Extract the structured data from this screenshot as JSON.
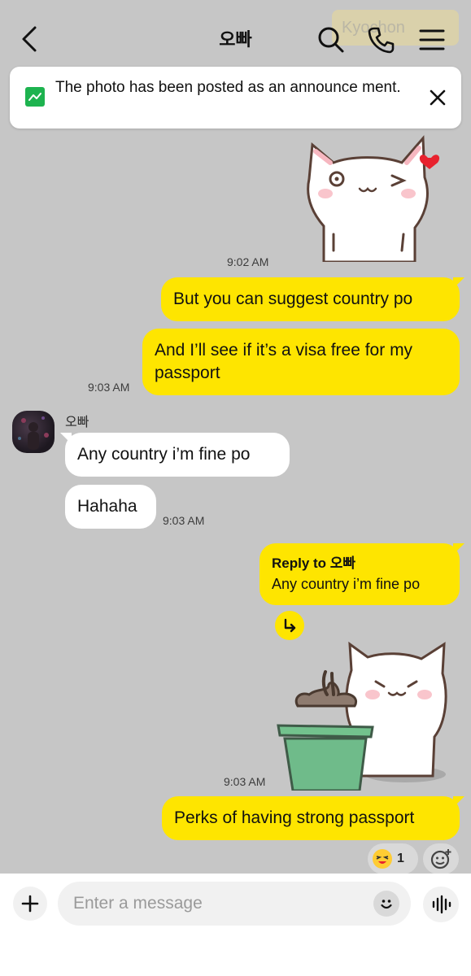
{
  "header": {
    "title": "오빠",
    "ghost_tag": "Kyochon",
    "back_icon": "chevron-left-icon",
    "search_icon": "search-icon",
    "call_icon": "phone-icon",
    "menu_icon": "hamburger-menu-icon"
  },
  "banner": {
    "icon": "announcement-image-icon",
    "text": "The photo has been posted as an announce ment.",
    "close_icon": "close-icon"
  },
  "messages": {
    "sticker1_time": "9:02 AM",
    "m1": "But you can suggest country po",
    "m2": "And I’ll see if it’s a visa free for my passport",
    "m2_time": "9:03 AM",
    "sender": "오빠",
    "o1": "Any country i’m fine po",
    "o2": "Hahaha",
    "o2_time": "9:03 AM",
    "reply_title": "Reply to 오빠",
    "reply_body": "Any country i’m fine po",
    "sticker2_time": "9:03 AM",
    "m3": "Perks of having strong passport"
  },
  "reactions": {
    "emoji_icon": "laughing-face-icon",
    "count": "1",
    "add_icon": "add-reaction-icon"
  },
  "input": {
    "placeholder": "Enter a message",
    "value": "",
    "plus_icon": "plus-icon",
    "emoji_icon": "emoticon-icon",
    "voice_icon": "voice-wave-icon"
  },
  "colors": {
    "background": "#c6c6c6",
    "my_bubble": "#fee500",
    "their_bubble": "#ffffff",
    "announce_icon": "#1db34f"
  }
}
